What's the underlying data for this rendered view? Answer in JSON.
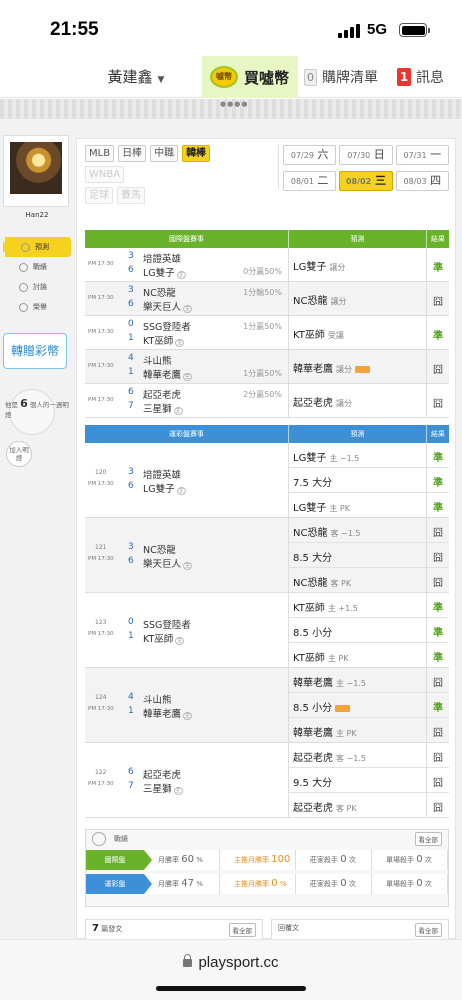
{
  "status_bar": {
    "time": "21:55",
    "network": "5G"
  },
  "nav": {
    "user": "黃建鑫",
    "coin_label": "買噓幣",
    "coin_icon_text": "噓幣",
    "cart_count": "0",
    "cart_label": "購牌清單",
    "msg_count": "1",
    "msg_label": "訊息"
  },
  "left": {
    "username": "Han22",
    "menu": [
      "預測",
      "戰績",
      "討論",
      "榮譽"
    ],
    "gift": "轉贈彩幣",
    "fans_pre": "他是",
    "fans_count": "6",
    "fans_post": "個人的一週明燈",
    "add": "加入明燈"
  },
  "filters": {
    "row1": [
      "MLB",
      "日棒",
      "中職",
      "韓棒"
    ],
    "active": "韓棒",
    "row2": [
      "WNBA"
    ],
    "row3": [
      "足球",
      "賽馬"
    ]
  },
  "dates": {
    "row1": [
      {
        "d": "07/29",
        "w": "六"
      },
      {
        "d": "07/30",
        "w": "日"
      },
      {
        "d": "07/31",
        "w": "一"
      }
    ],
    "row2": [
      {
        "d": "08/01",
        "w": "二"
      },
      {
        "d": "08/02",
        "w": "三"
      },
      {
        "d": "08/03",
        "w": "四"
      }
    ]
  },
  "intl": {
    "headers": [
      "國際盤賽事",
      "預測",
      "結果"
    ],
    "rows": [
      {
        "time": "PM 17:30",
        "s1": "3",
        "t1": "培證英雄",
        "s2": "6",
        "t2": "LG雙子",
        "odds": "0分贏50%",
        "odds_row": 2,
        "pick": "LG雙子",
        "pick_sub": "讓分",
        "hot": false,
        "result": "準",
        "win": true
      },
      {
        "time": "PM 17:30",
        "s1": "3",
        "t1": "NC恐龍",
        "s2": "6",
        "t2": "樂天巨人",
        "odds": "1分輸50%",
        "odds_row": 1,
        "pick": "NC恐龍",
        "pick_sub": "讓分",
        "hot": false,
        "result": "囧",
        "win": false
      },
      {
        "time": "PM 17:30",
        "s1": "0",
        "t1": "SSG登陸者",
        "s2": "1",
        "t2": "KT巫師",
        "odds": "1分贏50%",
        "odds_row": 1,
        "pick": "KT巫師",
        "pick_sub": "受讓",
        "hot": false,
        "result": "準",
        "win": true
      },
      {
        "time": "PM 17:30",
        "s1": "4",
        "t1": "斗山熊",
        "s2": "1",
        "t2": "韓華老鷹",
        "odds": "1分贏50%",
        "odds_row": 2,
        "pick": "韓華老鷹",
        "pick_sub": "讓分",
        "hot": true,
        "result": "囧",
        "win": false
      },
      {
        "time": "PM 17:30",
        "s1": "6",
        "t1": "起亞老虎",
        "s2": "7",
        "t2": "三星獅",
        "odds": "2分贏50%",
        "odds_row": 1,
        "pick": "起亞老虎",
        "pick_sub": "讓分",
        "hot": false,
        "result": "囧",
        "win": false
      }
    ]
  },
  "lottery": {
    "headers": [
      "運彩盤賽事",
      "預測",
      "結果"
    ],
    "games": [
      {
        "num": "120",
        "time": "PM 17:30",
        "s1": "3",
        "t1": "培證英雄",
        "s2": "6",
        "t2": "LG雙子",
        "picks": [
          {
            "p": "LG雙子",
            "sub": "主 −1.5",
            "hot": false,
            "r": "準",
            "win": true
          },
          {
            "p": "7.5 大分",
            "sub": "",
            "hot": false,
            "r": "準",
            "win": true
          },
          {
            "p": "LG雙子",
            "sub": "主 PK",
            "hot": false,
            "r": "準",
            "win": true
          }
        ]
      },
      {
        "num": "121",
        "time": "PM 17:30",
        "s1": "3",
        "t1": "NC恐龍",
        "s2": "6",
        "t2": "樂天巨人",
        "picks": [
          {
            "p": "NC恐龍",
            "sub": "客 −1.5",
            "hot": false,
            "r": "囧",
            "win": false
          },
          {
            "p": "8.5 大分",
            "sub": "",
            "hot": false,
            "r": "囧",
            "win": false
          },
          {
            "p": "NC恐龍",
            "sub": "客 PK",
            "hot": false,
            "r": "囧",
            "win": false
          }
        ]
      },
      {
        "num": "123",
        "time": "PM 17:30",
        "s1": "0",
        "t1": "SSG登陸者",
        "s2": "1",
        "t2": "KT巫師",
        "picks": [
          {
            "p": "KT巫師",
            "sub": "主 +1.5",
            "hot": false,
            "r": "準",
            "win": true
          },
          {
            "p": "8.5 小分",
            "sub": "",
            "hot": false,
            "r": "準",
            "win": true
          },
          {
            "p": "KT巫師",
            "sub": "主 PK",
            "hot": false,
            "r": "準",
            "win": true
          }
        ]
      },
      {
        "num": "124",
        "time": "PM 17:30",
        "s1": "4",
        "t1": "斗山熊",
        "s2": "1",
        "t2": "韓華老鷹",
        "picks": [
          {
            "p": "韓華老鷹",
            "sub": "主 −1.5",
            "hot": false,
            "r": "囧",
            "win": false
          },
          {
            "p": "8.5 小分",
            "sub": "",
            "hot": true,
            "r": "準",
            "win": true
          },
          {
            "p": "韓華老鷹",
            "sub": "主 PK",
            "hot": false,
            "r": "囧",
            "win": false
          }
        ]
      },
      {
        "num": "122",
        "time": "PM 17:30",
        "s1": "6",
        "t1": "起亞老虎",
        "s2": "7",
        "t2": "三星獅",
        "picks": [
          {
            "p": "起亞老虎",
            "sub": "客 −1.5",
            "hot": false,
            "r": "囧",
            "win": false
          },
          {
            "p": "9.5 大分",
            "sub": "",
            "hot": false,
            "r": "囧",
            "win": false
          },
          {
            "p": "起亞老虎",
            "sub": "客 PK",
            "hot": false,
            "r": "囧",
            "win": false
          }
        ]
      }
    ]
  },
  "stats": {
    "title": "戰績",
    "all": "看全部",
    "rows": [
      {
        "label": "國際盤",
        "color": "#69b32a",
        "month_label": "月勝率",
        "month_val": "60",
        "month_unit": "%",
        "main_label": "主推月勝率",
        "main_val": "100",
        "main_unit": "%",
        "killer_label": "莊家殺手",
        "killer_val": "0",
        "killer_unit": "次",
        "single_label": "單場殺手",
        "single_val": "0",
        "single_unit": "次"
      },
      {
        "label": "運彩盤",
        "color": "#3d8fd6",
        "month_label": "月勝率",
        "month_val": "47",
        "month_unit": "%",
        "main_label": "主推月勝率",
        "main_val": "0",
        "main_unit": "%",
        "killer_label": "莊家殺手",
        "killer_val": "0",
        "killer_unit": "次",
        "single_label": "單場殺手",
        "single_val": "0",
        "single_unit": "次"
      }
    ]
  },
  "bottom": {
    "left_count": "7",
    "left_label": "篇發文",
    "right_label": "回覆文",
    "all": "看全部"
  },
  "url": "playsport.cc"
}
